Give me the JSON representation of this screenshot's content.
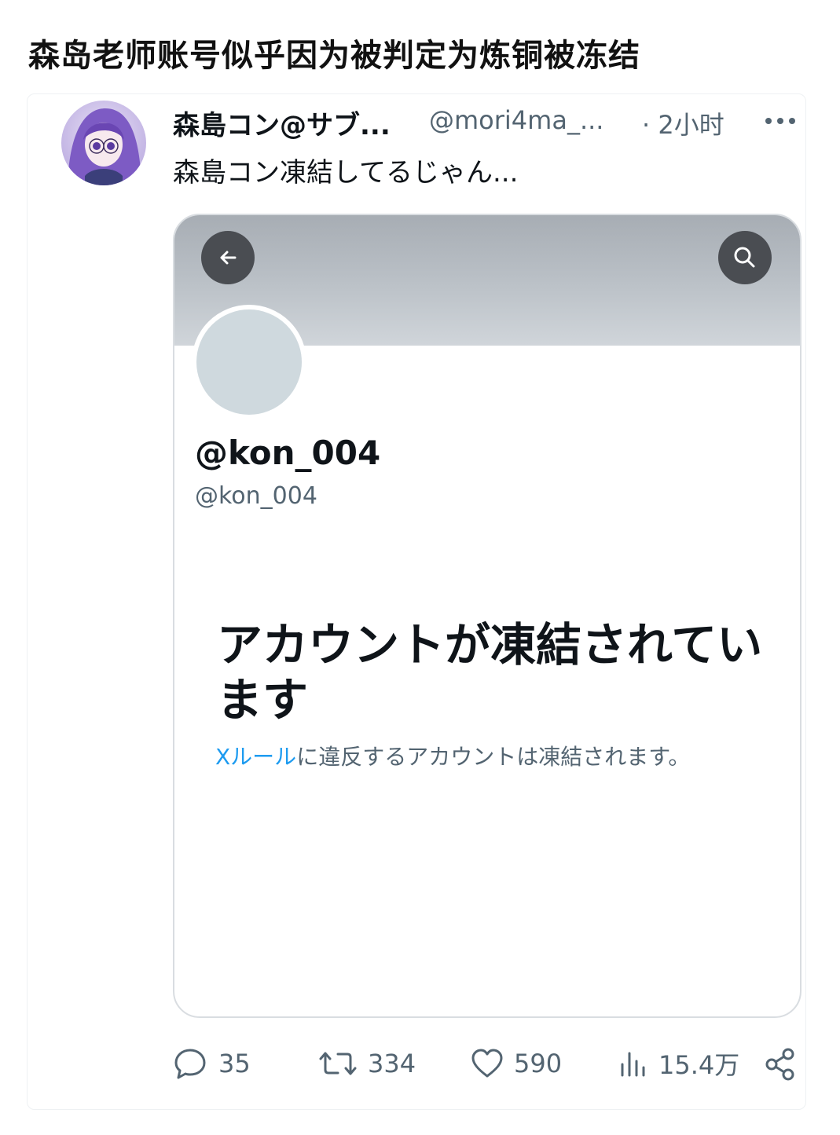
{
  "headline": "森岛老师账号似乎因为被判定为炼铜被冻结",
  "tweet": {
    "display_name": "森島コン@サブ...",
    "handle": "@mori4ma_...",
    "time": "· 2小时",
    "text": "森島コン凍結してるじゃん..."
  },
  "embedded_screenshot": {
    "profile_name": "@kon_004",
    "profile_handle": "@kon_004",
    "suspended_title": "アカウントが凍結されています",
    "rules_link": "Xルール",
    "rules_text": "に違反するアカウントは凍結されます。"
  },
  "actions": {
    "replies": "35",
    "retweets": "334",
    "likes": "590",
    "views": "15.4万"
  },
  "icons": {
    "more": "more-horizontal-icon",
    "back": "arrow-left-icon",
    "search": "search-icon",
    "reply": "comment-icon",
    "retweet": "retweet-icon",
    "like": "heart-icon",
    "views": "bar-chart-icon",
    "share": "share-icon"
  },
  "colors": {
    "link": "#1d9bf0",
    "secondary_text": "#536471",
    "banner_dark_button": "#4a4d52",
    "avatar_placeholder": "#cfd9de"
  }
}
